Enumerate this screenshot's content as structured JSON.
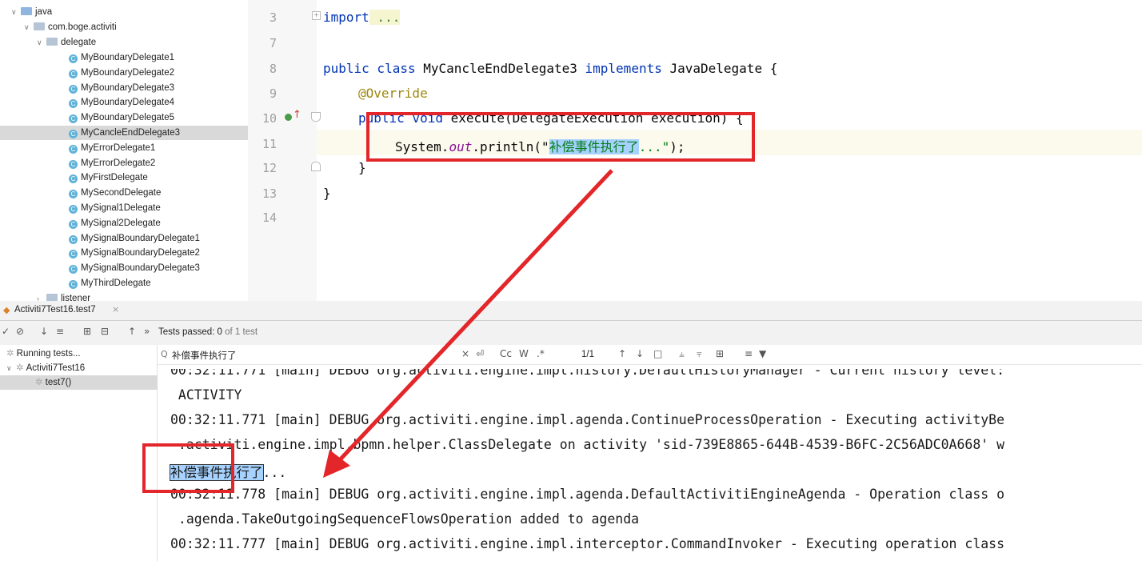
{
  "tree": {
    "java": "java",
    "package": "com.boge.activiti",
    "delegate_folder": "delegate",
    "classes": [
      "MyBoundaryDelegate1",
      "MyBoundaryDelegate2",
      "MyBoundaryDelegate3",
      "MyBoundaryDelegate4",
      "MyBoundaryDelegate5",
      "MyCancleEndDelegate3",
      "MyErrorDelegate1",
      "MyErrorDelegate2",
      "MyFirstDelegate",
      "MySecondDelegate",
      "MySignal1Delegate",
      "MySignal2Delegate",
      "MySignalBoundaryDelegate1",
      "MySignalBoundaryDelegate2",
      "MySignalBoundaryDelegate3",
      "MyThirdDelegate"
    ],
    "selected_class": "MyCancleEndDelegate3",
    "listener_folder": "listener",
    "class_badge": "C"
  },
  "editor": {
    "line_numbers": [
      "3",
      "7",
      "8",
      "9",
      "10",
      "11",
      "12",
      "13",
      "14"
    ],
    "line3": {
      "kw": "import",
      "rest": " ..."
    },
    "line8": {
      "kw1": "public class",
      "name": " MyCancleEndDelegate3 ",
      "kw2": "implements",
      "rest": " JavaDelegate {"
    },
    "line9": "@Override",
    "line10": {
      "kw": "public void",
      "rest": " execute(DelegateExecution execution) {"
    },
    "line11": {
      "pre": "System.",
      "field": "out",
      "mid": ".println(\"",
      "highlight": "补偿事件执行了",
      "str_rest": "...\"",
      "end": ");"
    },
    "line12": "}",
    "line13": "}"
  },
  "run": {
    "tab_label": "Activiti7Test16.test7",
    "status_prefix": "Tests passed: ",
    "status_count": "0",
    "status_suffix": " of 1 test",
    "search_value": "补偿事件执行了",
    "match_count": "1/1",
    "match_case": "Cc",
    "words": "W",
    "regex": ".*",
    "tree_items": [
      "Running tests...",
      "Activiti7Test16",
      "test7()"
    ]
  },
  "console": {
    "lines": [
      "00:32:11.771 [main] DEBUG org.activiti.engine.impl.history.DefaultHistoryManager - Current history level:",
      " ACTIVITY",
      "00:32:11.771 [main] DEBUG org.activiti.engine.impl.agenda.ContinueProcessOperation - Executing activityBe",
      " .activiti.engine.impl.bpmn.helper.ClassDelegate on activity 'sid-739E8865-644B-4539-B6FC-2C56ADC0A668' w",
      "",
      "00:32:11.778 [main] DEBUG org.activiti.engine.impl.agenda.DefaultActivitiEngineAgenda - Operation class o",
      " .agenda.TakeOutgoingSequenceFlowsOperation added to agenda",
      "00:32:11.777 [main] DEBUG org.activiti.engine.impl.interceptor.CommandInvoker - Executing operation class"
    ],
    "match_text": "补偿事件执行了",
    "match_suffix": "..."
  },
  "colors": {
    "annotation_red": "#e3262a",
    "highlight": "#a6d2ff"
  }
}
